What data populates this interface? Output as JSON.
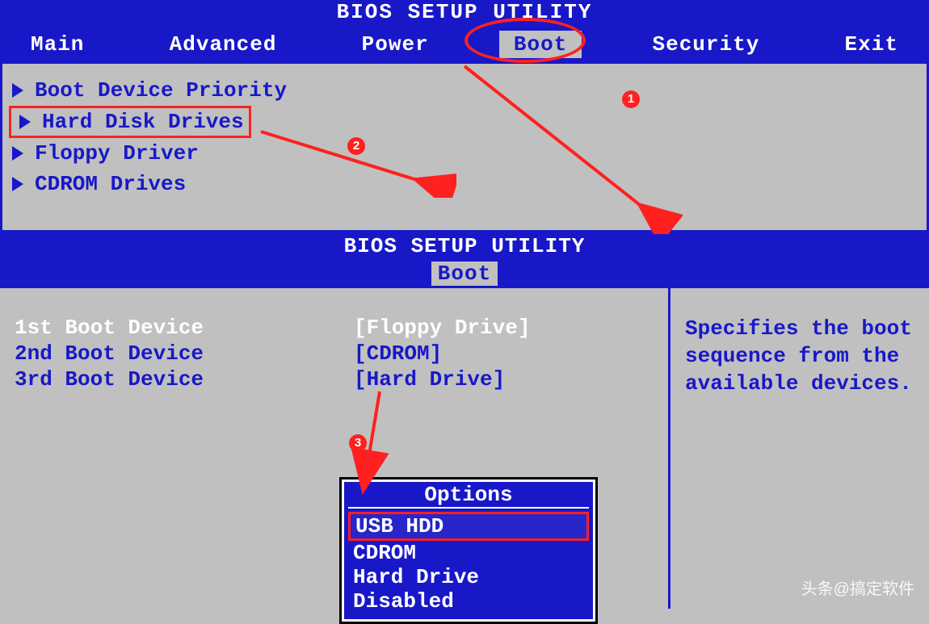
{
  "title": "BIOS SETUP UTILITY",
  "menu": {
    "items": [
      "Main",
      "Advanced",
      "Power",
      "Boot",
      "Security",
      "Exit"
    ],
    "selected": "Boot"
  },
  "top_panel": {
    "items": [
      {
        "label": "Boot Device Priority",
        "boxed": false
      },
      {
        "label": "Hard Disk Drives",
        "boxed": true
      },
      {
        "label": "Floppy Driver",
        "boxed": false
      },
      {
        "label": "CDROM Drives",
        "boxed": false
      }
    ]
  },
  "mid_header": {
    "title": "BIOS SETUP UTILITY",
    "tab": "Boot"
  },
  "boot_devices": [
    {
      "label": "1st Boot Device",
      "value": "[Floppy Drive]",
      "highlight": true
    },
    {
      "label": "2nd Boot Device",
      "value": "[CDROM]",
      "highlight": false
    },
    {
      "label": "3rd Boot Device",
      "value": "[Hard Drive]",
      "highlight": false
    }
  ],
  "options_popup": {
    "title": "Options",
    "items": [
      "USB HDD",
      "CDROM",
      "Hard Drive",
      "Disabled"
    ],
    "selected": "USB HDD"
  },
  "help_text": "Specifies the boot sequence from the available devices.",
  "annotations": {
    "badges": [
      "1",
      "2",
      "3"
    ]
  },
  "watermark": "头条@搞定软件"
}
